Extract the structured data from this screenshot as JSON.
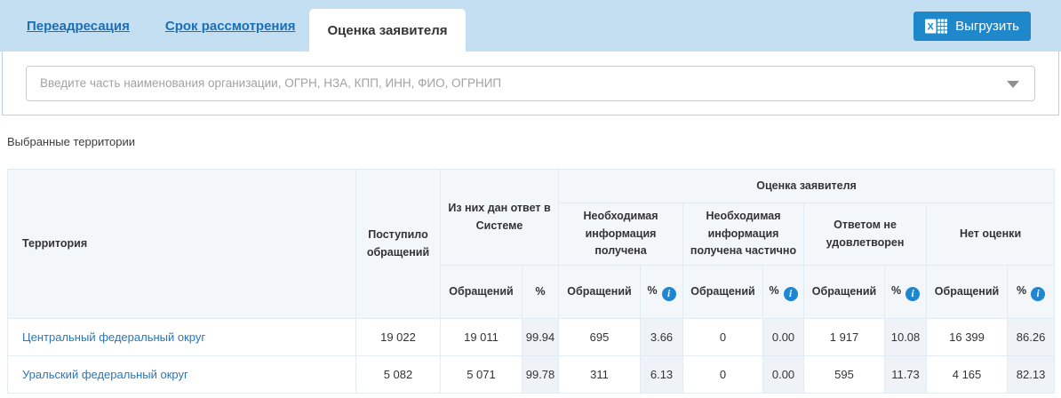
{
  "header": {
    "tabs": [
      {
        "label": "Переадресация"
      },
      {
        "label": "Срок рассмотрения"
      },
      {
        "label": "Оценка заявителя"
      }
    ],
    "active_tab": "Оценка заявителя",
    "export_button": {
      "label": "Выгрузить",
      "icon": "excel-icon"
    }
  },
  "search": {
    "value": "",
    "placeholder": "Введите часть наименования организации, ОГРН, НЗА, КПП, ИНН, ФИО, ОГРНИП",
    "dropdown_icon": "chevron-down"
  },
  "section": {
    "label": "Выбранные территории"
  },
  "table": {
    "headers": {
      "territory": "Территория",
      "received": "Поступило обращений",
      "answered_group": "Из них дан ответ в Системе",
      "rating_group": "Оценка заявителя",
      "subgroups": [
        "Необходимая информация получена",
        "Необходимая информация получена частично",
        "Ответом не удовлетворен",
        "Нет оценки"
      ],
      "appeals_col": "Обращений",
      "percent_col": "%",
      "info_icon_glyph": "i"
    },
    "rows": [
      {
        "territory": "Центральный федеральный округ",
        "received": "19 022",
        "answered": "19 011",
        "answered_pct": "99.94",
        "info_received": "695",
        "info_received_pct": "3.66",
        "info_partial": "0",
        "info_partial_pct": "0.00",
        "not_satisfied": "1 917",
        "not_satisfied_pct": "10.08",
        "no_rating": "16 399",
        "no_rating_pct": "86.26"
      },
      {
        "territory": "Уральский федеральный округ",
        "received": "5 082",
        "answered": "5 071",
        "answered_pct": "99.78",
        "info_received": "311",
        "info_received_pct": "6.13",
        "info_partial": "0",
        "info_partial_pct": "0.00",
        "not_satisfied": "595",
        "not_satisfied_pct": "11.73",
        "no_rating": "4 165",
        "no_rating_pct": "82.13"
      }
    ]
  },
  "colors": {
    "tabbar_bg": "#c4def2",
    "accent_blue": "#1e88cb",
    "link_blue": "#1a6fb5",
    "table_header_bg": "#f4f7fa",
    "pct_cell_bg": "#eff3f7",
    "info_icon_bg": "#1f87d2"
  }
}
